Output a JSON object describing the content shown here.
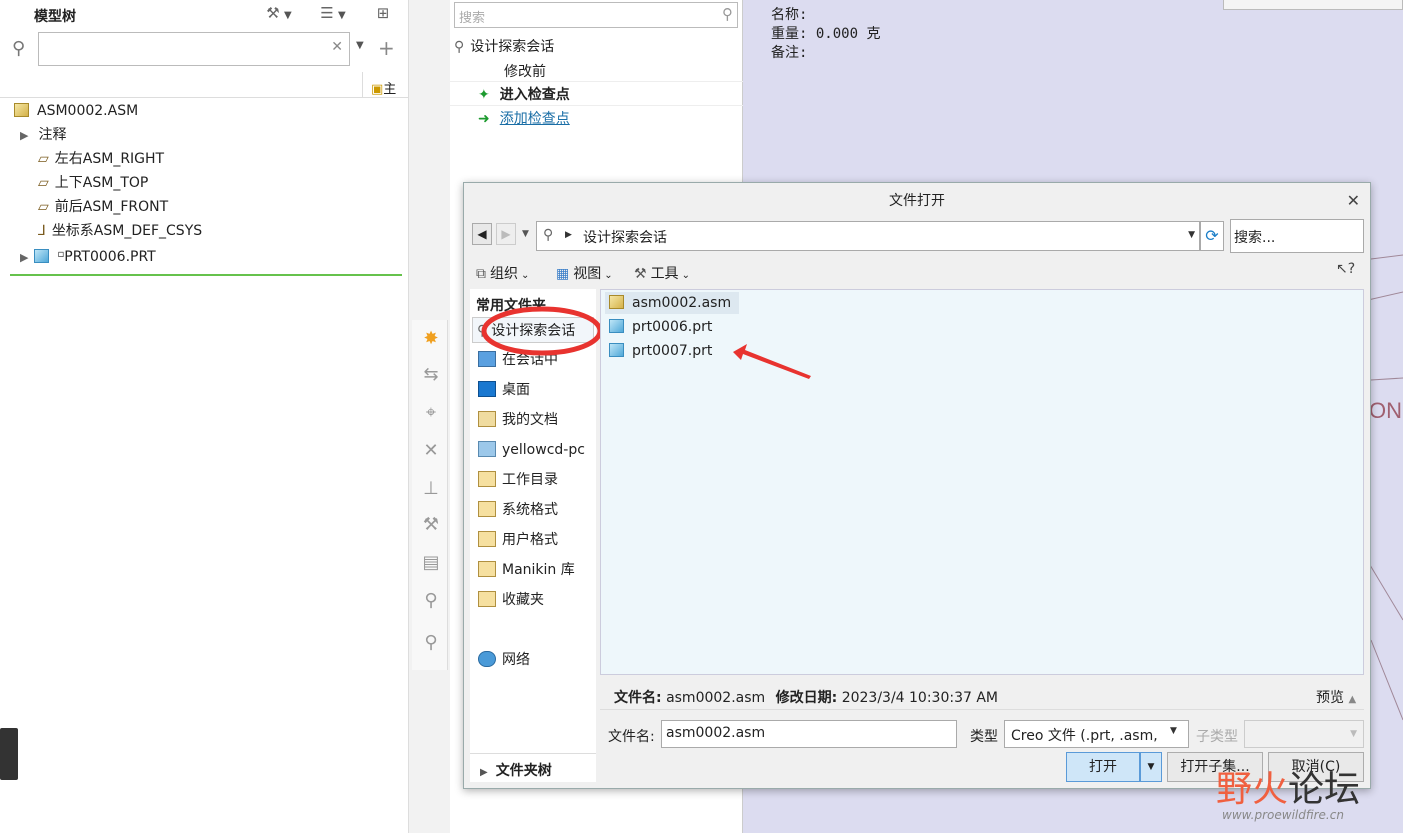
{
  "model_tree": {
    "title": "模型树",
    "main_label": "主",
    "items": [
      {
        "label": "ASM0002.ASM",
        "icon": "assembly-icon"
      },
      {
        "label": "注释",
        "icon": "expand-arrow"
      },
      {
        "label": "左右ASM_RIGHT",
        "icon": "datum-plane-icon"
      },
      {
        "label": "上下ASM_TOP",
        "icon": "datum-plane-icon"
      },
      {
        "label": "前后ASM_FRONT",
        "icon": "datum-plane-icon"
      },
      {
        "label": "坐标系ASM_DEF_CSYS",
        "icon": "csys-icon"
      },
      {
        "label": "PRT0006.PRT",
        "icon": "part-icon",
        "prefix": "▫"
      }
    ]
  },
  "navigator": {
    "search_placeholder": "搜索",
    "session": "设计探索会话",
    "items": [
      "修改前",
      "进入检查点",
      "添加检查点"
    ]
  },
  "info": {
    "name_label": "名称:",
    "weight_label": "重量:",
    "weight_value": "0.000 克",
    "note_label": "备注:"
  },
  "dialog": {
    "title": "文件打开",
    "path": "设计探索会话",
    "search_placeholder": "搜索...",
    "toolbar": {
      "organize": "组织",
      "view": "视图",
      "tools": "工具"
    },
    "sidebar_header": "常用文件夹",
    "sidebar_items": [
      "设计探索会话",
      "在会话中",
      "桌面",
      "我的文档",
      "yellowcd-pc",
      "工作目录",
      "系统格式",
      "用户格式",
      "Manikin 库",
      "收藏夹",
      "网络"
    ],
    "folder_tree": "文件夹树",
    "files": [
      "asm0002.asm",
      "prt0006.prt",
      "prt0007.prt"
    ],
    "status": {
      "filename_label": "文件名:",
      "filename": "asm0002.asm",
      "date_label": "修改日期:",
      "date": "2023/3/4 10:30:37 AM",
      "preview": "预览"
    },
    "filename_label": "文件名:",
    "filename_value": "asm0002.asm",
    "type_label": "类型",
    "type_value": "Creo 文件 (.prt, .asm,",
    "subtype_label": "子类型",
    "buttons": {
      "open": "打开",
      "open_sub": "打开子集...",
      "cancel": "取消(C)"
    }
  },
  "watermark": {
    "text1": "野火",
    "text2": "论坛",
    "url": "www.proewildfire.cn"
  },
  "colors": {
    "accent": "#3a8ec0",
    "annotation_red": "#e8332f",
    "green_line": "#66c24c"
  }
}
